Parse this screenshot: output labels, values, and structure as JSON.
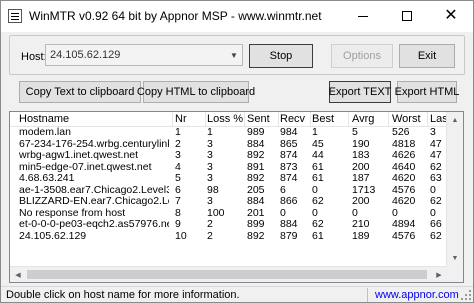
{
  "window": {
    "title": "WinMTR v0.92 64 bit by Appnor MSP - www.winmtr.net"
  },
  "host": {
    "label": "Host:",
    "value": "24.105.62.129"
  },
  "buttons": {
    "stop": "Stop",
    "options": "Options",
    "exit": "Exit",
    "copy_text": "Copy Text to clipboard",
    "copy_html": "Copy HTML to clipboard",
    "export_text": "Export TEXT",
    "export_html": "Export HTML"
  },
  "table": {
    "columns": [
      "Hostname",
      "Nr",
      "Loss %",
      "Sent",
      "Recv",
      "Best",
      "Avrg",
      "Worst",
      "Last"
    ],
    "rows": [
      [
        "modem.lan",
        "1",
        "1",
        "989",
        "984",
        "1",
        "5",
        "526",
        "3"
      ],
      [
        "67-234-176-254.wrbg.centurylink.net",
        "2",
        "3",
        "884",
        "865",
        "45",
        "190",
        "4818",
        "47"
      ],
      [
        "wrbg-agw1.inet.qwest.net",
        "3",
        "3",
        "892",
        "874",
        "44",
        "183",
        "4626",
        "47"
      ],
      [
        "min5-edge-07.inet.qwest.net",
        "4",
        "3",
        "891",
        "873",
        "61",
        "200",
        "4640",
        "62"
      ],
      [
        "4.68.63.241",
        "5",
        "3",
        "892",
        "874",
        "61",
        "187",
        "4620",
        "63"
      ],
      [
        "ae-1-3508.ear7.Chicago2.Level3.net",
        "6",
        "98",
        "205",
        "6",
        "0",
        "1713",
        "4576",
        "0"
      ],
      [
        "BLIZZARD-EN.ear7.Chicago2.Level3.net",
        "7",
        "3",
        "884",
        "866",
        "62",
        "200",
        "4620",
        "62"
      ],
      [
        "No response from host",
        "8",
        "100",
        "201",
        "0",
        "0",
        "0",
        "0",
        "0"
      ],
      [
        "et-0-0-0-pe03-eqch2.as57976.net",
        "9",
        "2",
        "899",
        "884",
        "62",
        "210",
        "4894",
        "66"
      ],
      [
        "24.105.62.129",
        "10",
        "2",
        "892",
        "879",
        "61",
        "189",
        "4576",
        "62"
      ]
    ]
  },
  "status": {
    "text": "Double click on host name for more information.",
    "link": "www.appnor.com"
  },
  "icons": {
    "app": "app-icon",
    "minimize": "minimize-icon",
    "maximize": "maximize-icon",
    "close": "close-icon"
  }
}
